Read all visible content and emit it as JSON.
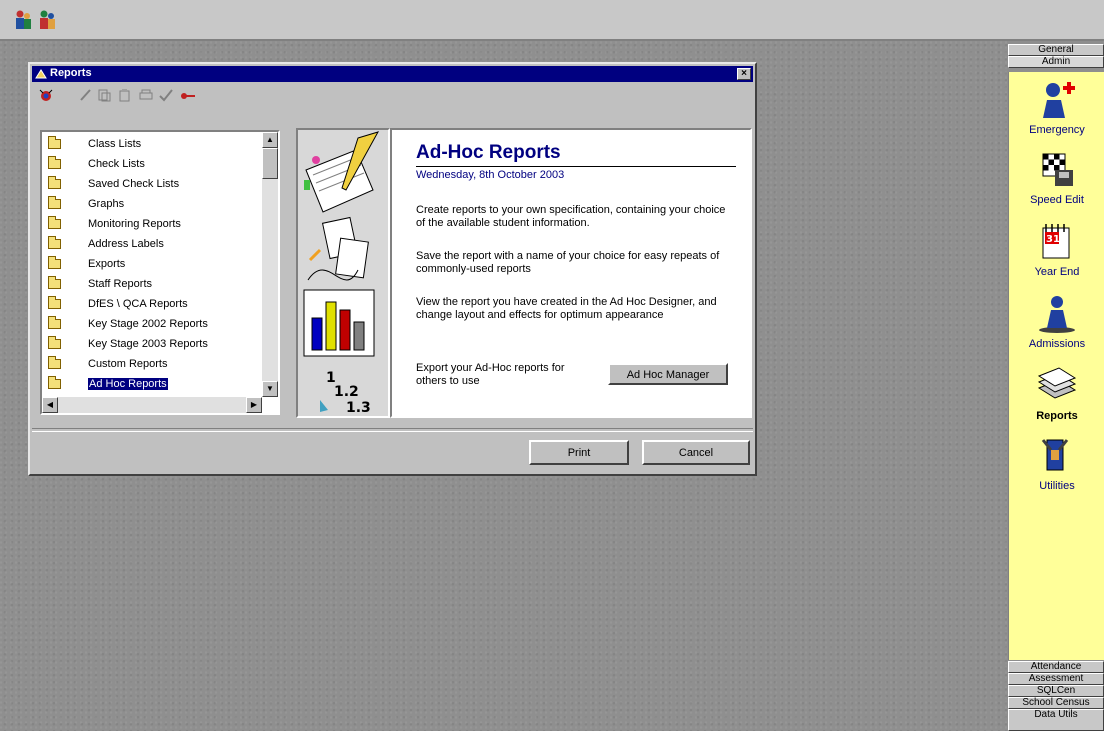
{
  "window": {
    "title": "Reports",
    "close_glyph": "×"
  },
  "report_list": {
    "items": [
      {
        "label": "Class Lists"
      },
      {
        "label": "Check Lists"
      },
      {
        "label": "Saved Check Lists"
      },
      {
        "label": "Graphs"
      },
      {
        "label": "Monitoring Reports"
      },
      {
        "label": "Address Labels"
      },
      {
        "label": "Exports"
      },
      {
        "label": "Staff Reports"
      },
      {
        "label": "DfES \\ QCA Reports"
      },
      {
        "label": "Key Stage 2002 Reports"
      },
      {
        "label": "Key Stage 2003 Reports"
      },
      {
        "label": "Custom Reports"
      },
      {
        "label": "Ad Hoc Reports",
        "selected": true
      }
    ]
  },
  "info": {
    "title": "Ad-Hoc Reports",
    "date": "Wednesday, 8th October 2003",
    "para1": "Create reports to your own specification, containing your choice of the available student information.",
    "para2": "Save the report with a name of your choice for easy repeats of commonly-used reports",
    "para3": "View the report you have created in the Ad Hoc Designer, and change layout and effects for optimum appearance",
    "para4": "Export your Ad-Hoc reports for others to use",
    "manager_button": "Ad Hoc Manager"
  },
  "footer": {
    "print_button": "Print",
    "cancel_button": "Cancel"
  },
  "nav": {
    "top_tabs": [
      "General",
      "Admin"
    ],
    "items": [
      {
        "label": "Emergency",
        "icon": "emergency-icon"
      },
      {
        "label": "Speed Edit",
        "icon": "speed-edit-icon"
      },
      {
        "label": "Year End",
        "icon": "calendar-icon"
      },
      {
        "label": "Admissions",
        "icon": "admissions-icon"
      },
      {
        "label": "Reports",
        "icon": "reports-icon",
        "active": true
      },
      {
        "label": "Utilities",
        "icon": "utilities-icon"
      }
    ],
    "bottom_tabs": [
      "Attendance",
      "Assessment",
      "SQLCen",
      "School Census",
      "Data Utils"
    ]
  },
  "colors": {
    "titlebar": "#000080",
    "nav_bg": "#ffff99",
    "selection": "#000080",
    "accent_text": "#000080"
  }
}
